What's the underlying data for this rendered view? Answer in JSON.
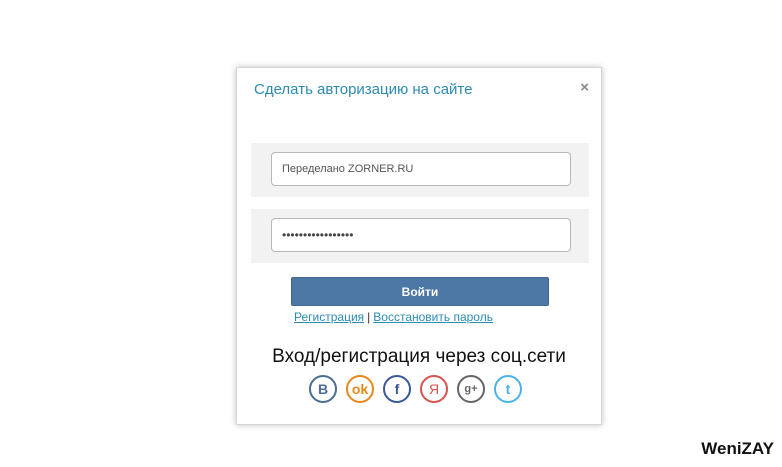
{
  "modal": {
    "title": "Сделать авторизацию на сайте",
    "close_glyph": "×",
    "login_field": {
      "value": "Переделано ZORNER.RU"
    },
    "password_field": {
      "value": "•••••••••••••••••"
    },
    "login_button_label": "Войти",
    "register_link": "Регистрация",
    "separator": "|",
    "restore_link": "Восстановить пароль",
    "social_heading": "Вход/регистрация через соц.сети",
    "social": [
      {
        "name": "vk-icon",
        "glyph": "B"
      },
      {
        "name": "odnoklassniki-icon",
        "glyph": "ok"
      },
      {
        "name": "facebook-icon",
        "glyph": "f"
      },
      {
        "name": "yandex-icon",
        "glyph": "Я"
      },
      {
        "name": "google-plus-icon",
        "glyph": "g+"
      },
      {
        "name": "twitter-icon",
        "glyph": "t"
      }
    ]
  },
  "watermark": "WeniZAY",
  "colors": {
    "title": "#2b8bb3",
    "button": "#4d77a4",
    "link": "#2b8bb3"
  }
}
